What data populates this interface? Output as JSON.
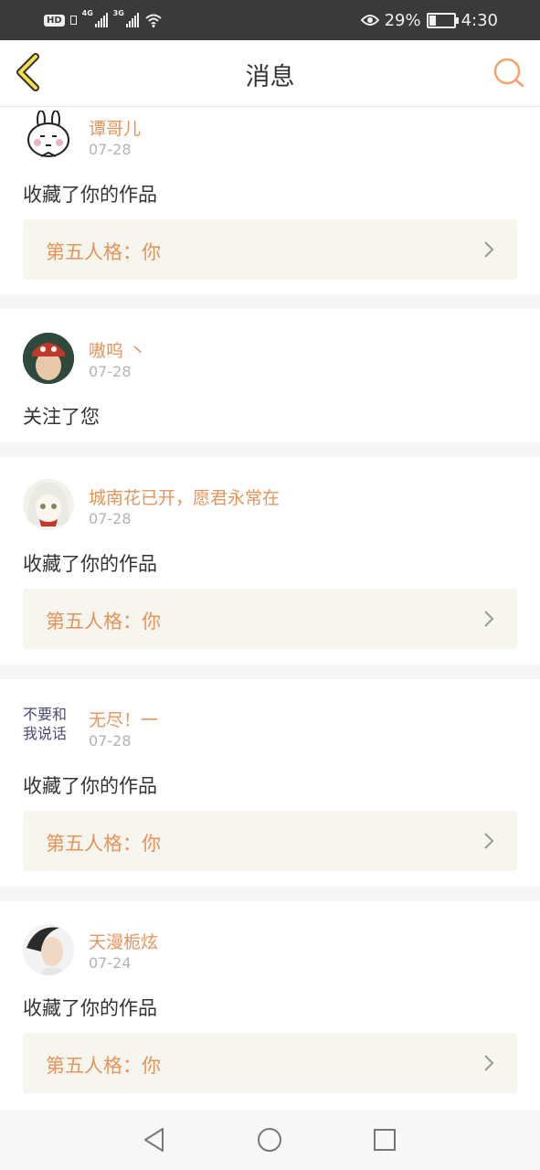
{
  "status_bar": {
    "hd": "HD",
    "sim1_gen": "4G",
    "sim2_gen": "3G",
    "battery_percent": "29%",
    "time": "4:30",
    "battery_level": 0.29
  },
  "header": {
    "title": "消息",
    "back_icon": "chevron-left-icon",
    "search_icon": "search-icon"
  },
  "messages": [
    {
      "username": "谭哥儿",
      "date": "07-28",
      "action": "收藏了你的作品",
      "work_title": "第五人格：你"
    },
    {
      "username": "嗷呜 丶",
      "date": "07-28",
      "action": "关注了您",
      "work_title": ""
    },
    {
      "username": "城南花已开，愿君永常在",
      "date": "07-28",
      "action": "收藏了你的作品",
      "work_title": "第五人格：你"
    },
    {
      "username": "无尽！一",
      "date": "07-28",
      "action": "收藏了你的作品",
      "work_title": "第五人格：你",
      "avatar_text": "不要和\n我说话"
    },
    {
      "username": "天漫栀炫",
      "date": "07-24",
      "action": "收藏了你的作品",
      "work_title": "第五人格：你"
    }
  ],
  "colors": {
    "accent": "#e8935a",
    "card_bg": "#f6f5ee",
    "divider": "#f5f5f5"
  },
  "navbar": {
    "back": "triangle-back-icon",
    "home": "circle-home-icon",
    "recent": "square-recent-icon"
  }
}
